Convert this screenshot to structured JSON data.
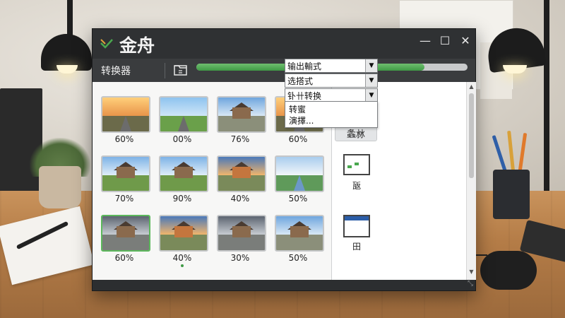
{
  "app": {
    "title": "金舟",
    "converter_label": "转换器",
    "progress": 0.84
  },
  "window_controls": {
    "minimize": "—",
    "maximize": "☐",
    "close": "✕"
  },
  "thumbnails": [
    {
      "percent": "60%",
      "scene": "road-sunset",
      "selected": false
    },
    {
      "percent": "00%",
      "scene": "fields",
      "selected": false
    },
    {
      "percent": "76%",
      "scene": "house-road",
      "selected": false
    },
    {
      "percent": "60%",
      "scene": "road-sunset",
      "selected": false
    },
    {
      "percent": "70%",
      "scene": "house",
      "selected": false
    },
    {
      "percent": "90%",
      "scene": "house",
      "selected": false
    },
    {
      "percent": "40%",
      "scene": "house-orange",
      "selected": false
    },
    {
      "percent": "50%",
      "scene": "river",
      "selected": false
    },
    {
      "percent": "60%",
      "scene": "house-dramatic",
      "selected": true
    },
    {
      "percent": "40%",
      "scene": "house-orange",
      "selected": false,
      "dot": true
    },
    {
      "percent": "30%",
      "scene": "house-dramatic",
      "selected": false
    },
    {
      "percent": "50%",
      "scene": "house-road",
      "selected": false
    }
  ],
  "side_panel": {
    "primary_button": "螽沝",
    "tools": [
      {
        "label": "瓪"
      },
      {
        "label": "田"
      }
    ]
  },
  "dropdowns": {
    "output_format": "输出輸式",
    "select_format": "选搭式",
    "batch_convert": "钋卄转换"
  },
  "dropdown_menu": {
    "items": [
      "转蜜",
      "演擇..."
    ]
  },
  "colors": {
    "accent_green": "#4aa84f",
    "title_bg": "#2f3133"
  }
}
